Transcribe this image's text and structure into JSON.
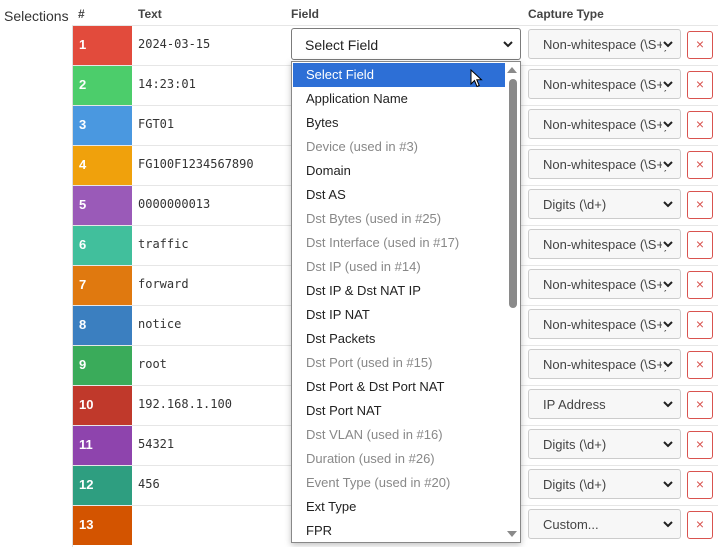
{
  "sidebar_label": "Selections",
  "headers": {
    "num": "#",
    "text": "Text",
    "field": "Field",
    "capture": "Capture Type"
  },
  "rows": [
    {
      "num": "1",
      "text": "2024-03-15",
      "color": "#e24b3c",
      "field": "Select Field",
      "capture": "Non-whitespace (\\S+)"
    },
    {
      "num": "2",
      "text": "14:23:01",
      "color": "#4ccd6b",
      "capture": "Non-whitespace (\\S+)"
    },
    {
      "num": "3",
      "text": "FGT01",
      "color": "#4a98e0",
      "capture": "Non-whitespace (\\S+)"
    },
    {
      "num": "4",
      "text": "FG100F1234567890",
      "color": "#f0a10c",
      "capture": "Non-whitespace (\\S+)"
    },
    {
      "num": "5",
      "text": "0000000013",
      "color": "#9a5ab8",
      "capture": "Digits (\\d+)"
    },
    {
      "num": "6",
      "text": "traffic",
      "color": "#41bf9c",
      "capture": "Non-whitespace (\\S+)"
    },
    {
      "num": "7",
      "text": "forward",
      "color": "#e0790f",
      "capture": "Non-whitespace (\\S+)"
    },
    {
      "num": "8",
      "text": "notice",
      "color": "#3b7fc0",
      "capture": "Non-whitespace (\\S+)"
    },
    {
      "num": "9",
      "text": "root",
      "color": "#3aab5a",
      "capture": "Non-whitespace (\\S+)"
    },
    {
      "num": "10",
      "text": "192.168.1.100",
      "color": "#c0392b",
      "capture": "IP Address"
    },
    {
      "num": "11",
      "text": "54321",
      "color": "#8e44ad",
      "capture": "Digits (\\d+)"
    },
    {
      "num": "12",
      "text": "456",
      "color": "#2e9e80",
      "capture": "Digits (\\d+)"
    },
    {
      "num": "13",
      "text": "",
      "color": "#d35400",
      "capture": "Custom..."
    }
  ],
  "remove_label": "×",
  "dropdown_options": [
    {
      "label": "Select Field",
      "state": "selected"
    },
    {
      "label": "Application Name",
      "state": "enabled"
    },
    {
      "label": "Bytes",
      "state": "enabled"
    },
    {
      "label": "Device (used in #3)",
      "state": "disabled"
    },
    {
      "label": "Domain",
      "state": "enabled"
    },
    {
      "label": "Dst AS",
      "state": "enabled"
    },
    {
      "label": "Dst Bytes (used in #25)",
      "state": "disabled"
    },
    {
      "label": "Dst Interface (used in #17)",
      "state": "disabled"
    },
    {
      "label": "Dst IP (used in #14)",
      "state": "disabled"
    },
    {
      "label": "Dst IP & Dst NAT IP",
      "state": "enabled"
    },
    {
      "label": "Dst IP NAT",
      "state": "enabled"
    },
    {
      "label": "Dst Packets",
      "state": "enabled"
    },
    {
      "label": "Dst Port (used in #15)",
      "state": "disabled"
    },
    {
      "label": "Dst Port & Dst Port NAT",
      "state": "enabled"
    },
    {
      "label": "Dst Port NAT",
      "state": "enabled"
    },
    {
      "label": "Dst VLAN (used in #16)",
      "state": "disabled"
    },
    {
      "label": "Duration (used in #26)",
      "state": "disabled"
    },
    {
      "label": "Event Type (used in #20)",
      "state": "disabled"
    },
    {
      "label": "Ext Type",
      "state": "enabled"
    },
    {
      "label": "FPR",
      "state": "enabled"
    }
  ],
  "colors": {
    "accent": "#2d6fd6",
    "danger": "#d9534f"
  }
}
